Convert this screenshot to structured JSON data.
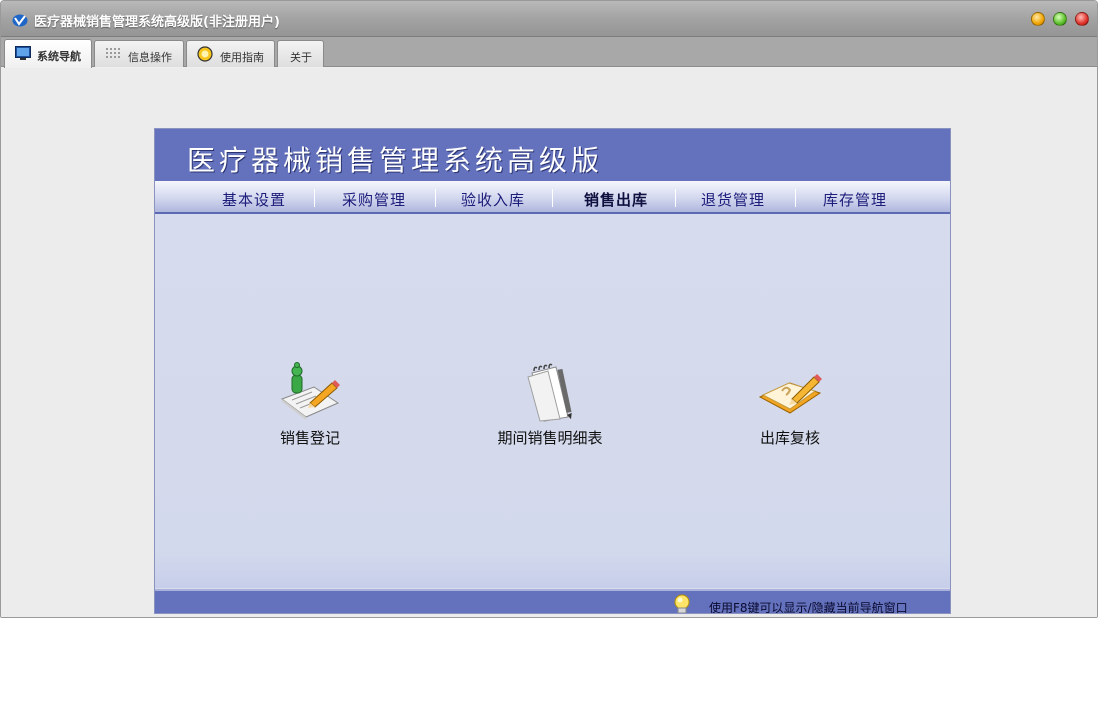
{
  "window": {
    "title": "医疗器械销售管理系统高级版(非注册用户)",
    "app_icon": "app-logo-icon"
  },
  "tabs": [
    {
      "label": "系统导航",
      "icon": "monitor-icon",
      "active": true
    },
    {
      "label": "信息操作",
      "icon": "grid-icon",
      "active": false
    },
    {
      "label": "使用指南",
      "icon": "lightbulb-icon",
      "active": false
    },
    {
      "label": "关于",
      "icon": "",
      "active": false
    }
  ],
  "panel": {
    "title": "医疗器械销售管理系统高级版",
    "menu": [
      {
        "label": "基本设置",
        "active": false
      },
      {
        "label": "采购管理",
        "active": false
      },
      {
        "label": "验收入库",
        "active": false
      },
      {
        "label": "销售出库",
        "active": true
      },
      {
        "label": "退货管理",
        "active": false
      },
      {
        "label": "库存管理",
        "active": false
      }
    ],
    "functions": [
      {
        "label": "销售登记",
        "icon": "sales-register-icon"
      },
      {
        "label": "期间销售明细表",
        "icon": "notepad-icon"
      },
      {
        "label": "出库复核",
        "icon": "book-pencil-icon"
      }
    ],
    "footer_tip": "使用F8键可以显示/隐藏当前导航窗口"
  },
  "colors": {
    "header_blue": "#6472bd",
    "body_bg": "#d6dced",
    "menu_text": "#1c1c7a"
  }
}
